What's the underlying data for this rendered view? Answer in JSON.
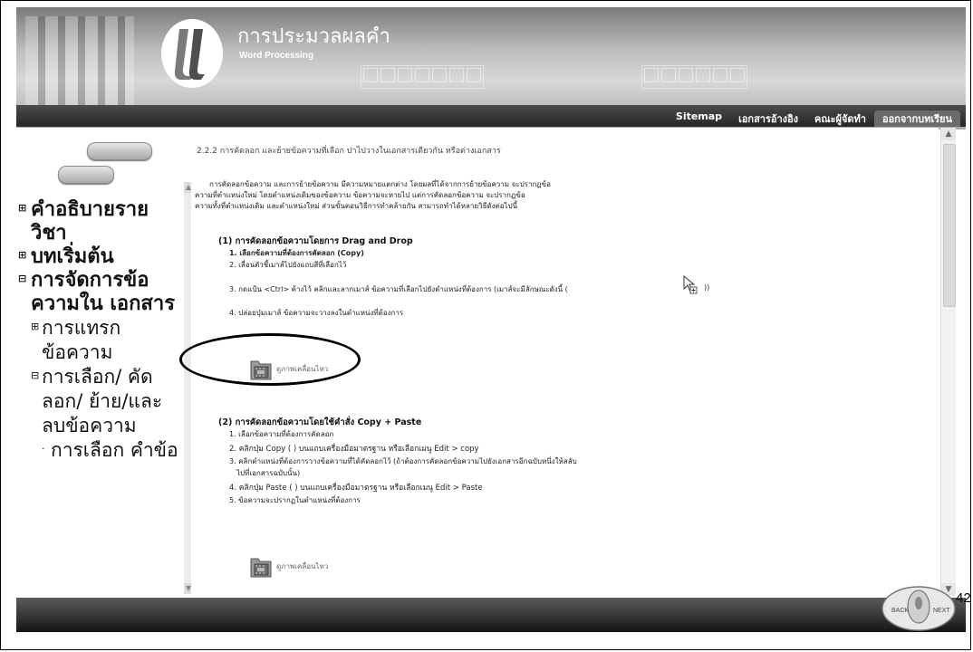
{
  "header": {
    "title_th": "การประมวลผลคำ",
    "title_en": "Word Processing"
  },
  "nav": {
    "links": [
      "Sitemap",
      "เอกสารอ้างอิง",
      "คณะผู้จัดทำ",
      "ออกจากบทเรียน"
    ]
  },
  "sidebar": {
    "items": [
      {
        "label": "คำอธิบายราย วิชา",
        "marker": "⊞"
      },
      {
        "label": "บทเริ่มต้น",
        "marker": "⊞"
      },
      {
        "label": "การจัดการข้อ ความใน เอกสาร",
        "marker": "⊟"
      },
      {
        "label": "การแทรก ข้อความ",
        "marker": "⊞"
      },
      {
        "label": "การเลือก/ คัดลอก/ ย้าย/และ ลบข้อความ",
        "marker": "⊟"
      },
      {
        "label": "การเลือก คำข้อ",
        "marker": "·"
      }
    ]
  },
  "content": {
    "section_title": "2.2.2 การคัดลอก และย้ายข้อความที่เลือก ปาไปวางในเอกสารเดียวกัน หรือต่างเอกสาร",
    "intro_lines": [
      "การคัดลอกข้อความ และการย้ายข้อความ มีความหมายแตกต่าง โดยผลที่ได้จากการย้ายข้อความ จะปรากฏข้อ",
      "ความที่ตำแหน่งใหม่ โดยตำแหน่งเดิมของข้อความ ข้อความจะหายไป แต่การคัดลอกข้อความ จะปรากฏข้อ",
      "ความทั้งที่ตำแหน่งเดิม และตำแหน่งใหม่ ส่วนขั้นตอนวิธีการทำคล้ายกัน สามารถทำได้หลายวิธีดังต่อไปนี้"
    ],
    "part1": {
      "heading": "(1) การคัดลอกข้อความโดยการ Drag and Drop",
      "steps": [
        "1. เลือกข้อความที่ต้องการคัดลอก (Copy)",
        "2. เลื่อนตัวชี้เมาส์ไปยังแถบสีที่เลือกไว้",
        "3. กดแป้น <Ctrl> ค้างไว้ คลิกและลากเมาส์ ข้อความที่เลือกไปยังตำแหน่งที่ต้องการ (เมาส์จะมีลักษณะดังนี้ (",
        "4. ปล่อยปุ่มเมาส์ ข้อความจะวางลงในตำแหน่งที่ต้องการ"
      ],
      "step3_tail": "))"
    },
    "anim_label_1": "ดูภาพเคลื่อนไหว",
    "part2": {
      "heading": "(2) การคัดลอกข้อความโดยใช้คำสั่ง Copy + Paste",
      "steps": [
        "1. เลือกข้อความที่ต้องการคัดลอก",
        "2. คลิกปุ่ม Copy ( ) บนแถบเครื่องมือมาตรฐาน หรือเลือกเมนู Edit > copy",
        "3. คลิกตำแหน่งที่ต้องการวางข้อความที่ได้คัดลอกไว้ (ถ้าต้องการคัดลอกข้อความไปยังเอกสารอีกฉบับหนึ่งให้สลับ",
        "ไปที่เอกสารฉบับนั้น)",
        "4. คลิกปุ่ม Paste ( ) บนแถบเครื่องมือมาตรฐาน หรือเลือกเมนู Edit > Paste",
        "5. ข้อความจะปรากฏในตำแหน่งที่ต้องการ"
      ]
    },
    "anim_label_2": "ดูภาพเคลื่อนไหว"
  },
  "footer": {
    "back_label": "BACK",
    "next_label": "NEXT",
    "page_number": "42"
  },
  "colors": {
    "navbar": "#2b2b2b",
    "header": "#bdbdbd",
    "footer": "#1a1a1a"
  }
}
